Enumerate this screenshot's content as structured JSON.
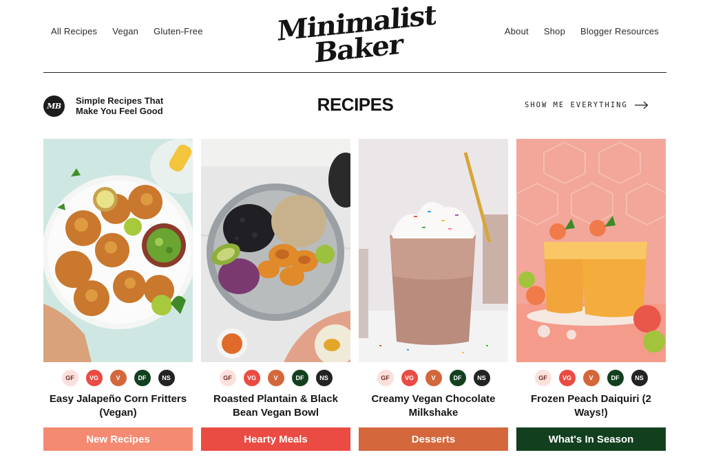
{
  "nav": {
    "left": [
      "All Recipes",
      "Vegan",
      "Gluten-Free"
    ],
    "right": [
      "About",
      "Shop",
      "Blogger Resources"
    ]
  },
  "logo": {
    "line1": "Minimalist",
    "line2": "Baker"
  },
  "tagline": {
    "badge": "MB",
    "text": "Simple Recipes That Make You Feel Good"
  },
  "section": {
    "title": "RECIPES",
    "show_all": "SHOW ME EVERYTHING"
  },
  "tags": [
    "GF",
    "VG",
    "V",
    "DF",
    "NS"
  ],
  "recipes": [
    {
      "title": "Easy Jalapeño Corn Fritters (Vegan)"
    },
    {
      "title": "Roasted Plantain & Black Bean Vegan Bowl"
    },
    {
      "title": "Creamy Vegan Chocolate Milkshake"
    },
    {
      "title": "Frozen Peach Daiquiri (2 Ways!)"
    }
  ],
  "categories": [
    {
      "label": "New Recipes",
      "color": "#f58a73"
    },
    {
      "label": "Hearty Meals",
      "color": "#ea4b42"
    },
    {
      "label": "Desserts",
      "color": "#d4673c"
    },
    {
      "label": "What's In Season",
      "color": "#12401f"
    }
  ]
}
